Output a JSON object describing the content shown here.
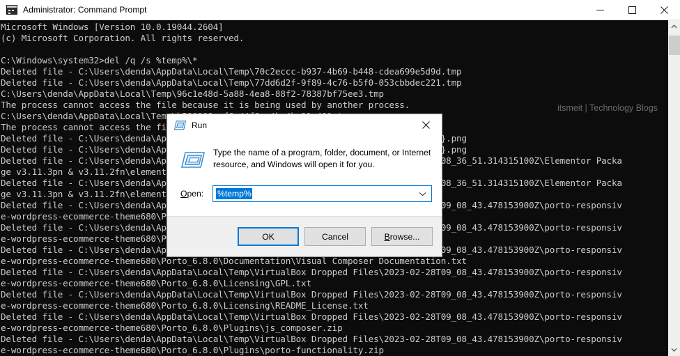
{
  "window": {
    "title": "Administrator: Command Prompt",
    "icon": "console-icon",
    "minimize_label": "Minimize",
    "maximize_label": "Maximize",
    "close_label": "Close"
  },
  "watermark": "itsmeit | Technology Blogs",
  "console": {
    "lines": [
      "Microsoft Windows [Version 10.0.19044.2604]",
      "(c) Microsoft Corporation. All rights reserved.",
      "",
      "C:\\Windows\\system32>del /q /s %temp%\\*",
      "Deleted file - C:\\Users\\denda\\AppData\\Local\\Temp\\70c2eccc-b937-4b69-b448-cdea699e5d9d.tmp",
      "Deleted file - C:\\Users\\denda\\AppData\\Local\\Temp\\77dd6d2f-9f89-4c76-b5f0-053cbbdec221.tmp",
      "C:\\Users\\denda\\AppData\\Local\\Temp\\96c1e48d-5a88-4ea8-88f2-78387bf75ee3.tmp",
      "The process cannot access the file because it is being used by another process.",
      "C:\\Users\\denda\\AppData\\Local\\Temp\\b580109-af6-44f6-a4b-4be91e491.tmp",
      "The process cannot access the file because it is being used by another process.",
      "Deleted file - C:\\Users\\denda\\AppData\\Local\\Temp\\{F0A10B1F-9D2E-4C3A-B5D7-00C38A537BA}.png",
      "Deleted file - C:\\Users\\denda\\AppData\\Local\\Temp\\{3B7D41C9-6E5A-42B8-9F1C-7A2EC74DAE6}.png",
      "Deleted file - C:\\Users\\denda\\AppData\\Local\\Temp\\VirtualBox Dropped Files\\2023-02-28T08_36_51.314315100Z\\Elementor Packa",
      "ge v3.11.3pn & v3.11.2fn\\elementor-pro-3.11.3.zip",
      "Deleted file - C:\\Users\\denda\\AppData\\Local\\Temp\\VirtualBox Dropped Files\\2023-02-28T08_36_51.314315100Z\\Elementor Packa",
      "ge v3.11.3pn & v3.11.2fn\\elementor-3.11.2.zip",
      "Deleted file - C:\\Users\\denda\\AppData\\Local\\Temp\\VirtualBox Dropped Files\\2023-02-28T09_08_43.478153900Z\\porto-responsiv",
      "e-wordpress-ecommerce-theme680\\Porto_6.8.0\\Documentation\\index.html",
      "Deleted file - C:\\Users\\denda\\AppData\\Local\\Temp\\VirtualBox Dropped Files\\2023-02-28T09_08_43.478153900Z\\porto-responsiv",
      "e-wordpress-ecommerce-theme680\\Porto_6.8.0\\Documentation\\Porto Documentation.html",
      "Deleted file - C:\\Users\\denda\\AppData\\Local\\Temp\\VirtualBox Dropped Files\\2023-02-28T09_08_43.478153900Z\\porto-responsiv",
      "e-wordpress-ecommerce-theme680\\Porto_6.8.0\\Documentation\\Visual Composer Documentation.txt",
      "Deleted file - C:\\Users\\denda\\AppData\\Local\\Temp\\VirtualBox Dropped Files\\2023-02-28T09_08_43.478153900Z\\porto-responsiv",
      "e-wordpress-ecommerce-theme680\\Porto_6.8.0\\Licensing\\GPL.txt",
      "Deleted file - C:\\Users\\denda\\AppData\\Local\\Temp\\VirtualBox Dropped Files\\2023-02-28T09_08_43.478153900Z\\porto-responsiv",
      "e-wordpress-ecommerce-theme680\\Porto_6.8.0\\Licensing\\README_License.txt",
      "Deleted file - C:\\Users\\denda\\AppData\\Local\\Temp\\VirtualBox Dropped Files\\2023-02-28T09_08_43.478153900Z\\porto-responsiv",
      "e-wordpress-ecommerce-theme680\\Porto_6.8.0\\Plugins\\js_composer.zip",
      "Deleted file - C:\\Users\\denda\\AppData\\Local\\Temp\\VirtualBox Dropped Files\\2023-02-28T09_08_43.478153900Z\\porto-responsiv",
      "e-wordpress-ecommerce-theme680\\Porto_6.8.0\\Plugins\\porto-functionality.zip"
    ],
    "background": "#0c0c0c",
    "foreground": "#cccccc"
  },
  "run_dialog": {
    "title": "Run",
    "icon": "run-icon",
    "close_label": "Close",
    "description": "Type the name of a program, folder, document, or Internet resource, and Windows will open it for you.",
    "open_label_prefix": "",
    "open_label_accel": "O",
    "open_label_rest": "pen:",
    "input_value": "%temp%",
    "input_selected": true,
    "buttons": {
      "ok": "OK",
      "cancel": "Cancel",
      "browse_accel": "B",
      "browse_rest": "rowse..."
    },
    "accent": "#0078d7"
  },
  "scrollbar": {
    "up_label": "Scroll up",
    "down_label": "Scroll down",
    "thumb_label": "Scroll thumb"
  }
}
